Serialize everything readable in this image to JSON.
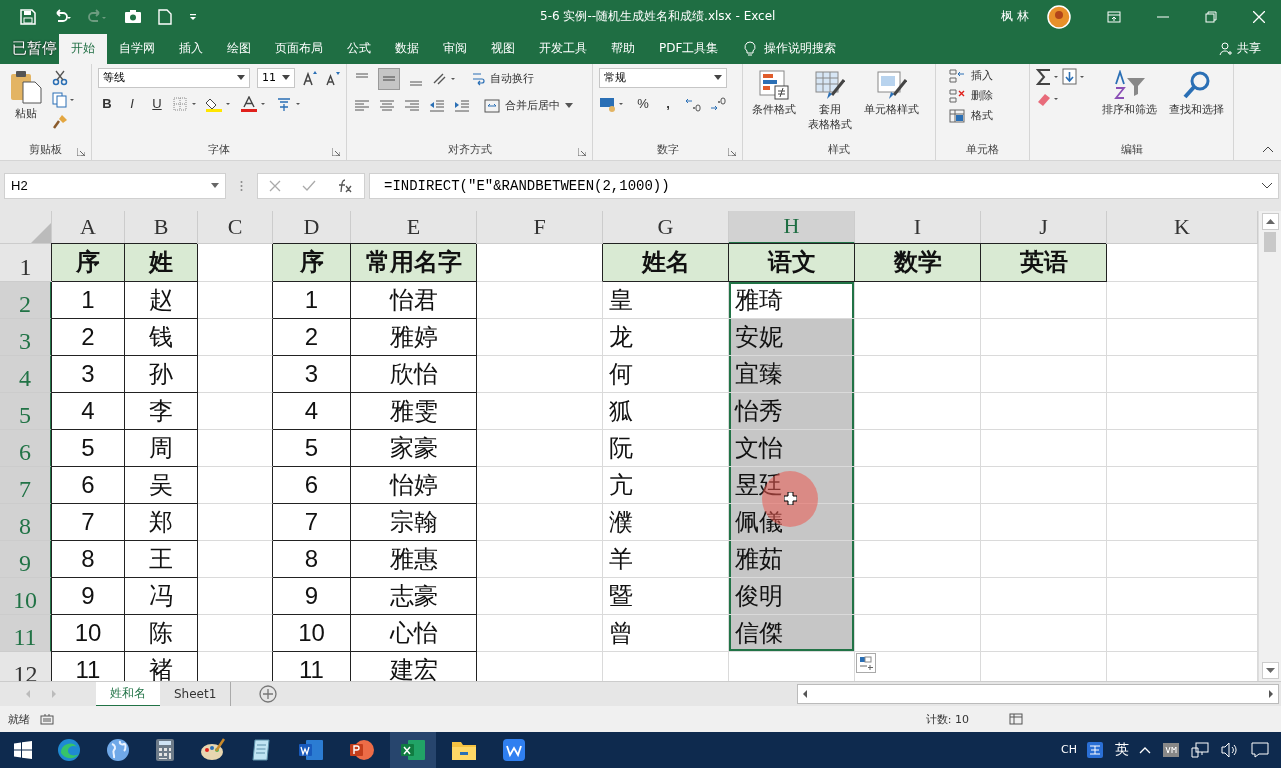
{
  "title_bar": {
    "title": "5-6 实例--随机生成姓名和成绩.xlsx  -  Excel",
    "user": "枫 林"
  },
  "recorder_status": "已暂停",
  "tabs": [
    {
      "label": "开始",
      "selected": true
    },
    {
      "label": "自学网",
      "selected": false
    },
    {
      "label": "插入",
      "selected": false
    },
    {
      "label": "绘图",
      "selected": false
    },
    {
      "label": "页面布局",
      "selected": false
    },
    {
      "label": "公式",
      "selected": false
    },
    {
      "label": "数据",
      "selected": false
    },
    {
      "label": "审阅",
      "selected": false
    },
    {
      "label": "视图",
      "selected": false
    },
    {
      "label": "开发工具",
      "selected": false
    },
    {
      "label": "帮助",
      "selected": false
    },
    {
      "label": "PDF工具集",
      "selected": false
    }
  ],
  "tell_me": "操作说明搜索",
  "share": "共享",
  "ribbon": {
    "clipboard": {
      "paste": "粘贴",
      "label": "剪贴板"
    },
    "font": {
      "name": "等线",
      "size": "11",
      "bold": "B",
      "italic": "I",
      "underline": "U",
      "label": "字体"
    },
    "alignment": {
      "wrap": "自动换行",
      "merge": "合并后居中",
      "label": "对齐方式"
    },
    "number": {
      "format": "常规",
      "percent": "%",
      "comma": ",",
      "label": "数字"
    },
    "styles": {
      "conditional": "条件格式",
      "table_format_1": "套用",
      "table_format_2": "表格格式",
      "cell_styles": "单元格样式",
      "label": "样式"
    },
    "cells": {
      "insert": "插入",
      "delete": "删除",
      "format": "格式",
      "label": "单元格"
    },
    "editing": {
      "sort": "排序和筛选",
      "find": "查找和选择",
      "label": "编辑"
    }
  },
  "formula_bar": {
    "name_box": "H2",
    "formula": "=INDIRECT(\"E\"&RANDBETWEEN(2,1000))"
  },
  "columns": [
    {
      "letter": "A",
      "selected": false
    },
    {
      "letter": "B",
      "selected": false
    },
    {
      "letter": "C",
      "selected": false
    },
    {
      "letter": "D",
      "selected": false
    },
    {
      "letter": "E",
      "selected": false
    },
    {
      "letter": "F",
      "selected": false
    },
    {
      "letter": "G",
      "selected": false
    },
    {
      "letter": "H",
      "selected": true
    },
    {
      "letter": "I",
      "selected": false
    },
    {
      "letter": "J",
      "selected": false
    },
    {
      "letter": "K",
      "selected": false
    }
  ],
  "rows": [
    {
      "number": "1",
      "selected": false,
      "cells": [
        {
          "kind": "header",
          "text": "序"
        },
        {
          "kind": "header",
          "text": "姓"
        },
        {
          "kind": "blank"
        },
        {
          "kind": "header",
          "text": "序"
        },
        {
          "kind": "header",
          "text": "常用名字"
        },
        {
          "kind": "blank"
        },
        {
          "kind": "header",
          "text": "姓名"
        },
        {
          "kind": "header",
          "text": "语文"
        },
        {
          "kind": "header",
          "text": "数学"
        },
        {
          "kind": "header",
          "text": "英语"
        },
        {
          "kind": "blank"
        }
      ]
    },
    {
      "number": "2",
      "selected": true,
      "cells": [
        {
          "kind": "table",
          "text": "1"
        },
        {
          "kind": "table",
          "text": "赵"
        },
        {
          "kind": "blank"
        },
        {
          "kind": "table",
          "text": "1"
        },
        {
          "kind": "table",
          "text": "怡君"
        },
        {
          "kind": "blank"
        },
        {
          "kind": "plain",
          "text": "皇"
        },
        {
          "kind": "active",
          "text": "雅琦"
        },
        {
          "kind": "blank"
        },
        {
          "kind": "blank"
        },
        {
          "kind": "blank"
        }
      ]
    },
    {
      "number": "3",
      "selected": true,
      "cells": [
        {
          "kind": "table",
          "text": "2"
        },
        {
          "kind": "table",
          "text": "钱"
        },
        {
          "kind": "blank"
        },
        {
          "kind": "table",
          "text": "2"
        },
        {
          "kind": "table",
          "text": "雅婷"
        },
        {
          "kind": "blank"
        },
        {
          "kind": "plain",
          "text": "龙"
        },
        {
          "kind": "selected",
          "text": "安妮"
        },
        {
          "kind": "blank"
        },
        {
          "kind": "blank"
        },
        {
          "kind": "blank"
        }
      ]
    },
    {
      "number": "4",
      "selected": true,
      "cells": [
        {
          "kind": "table",
          "text": "3"
        },
        {
          "kind": "table",
          "text": "孙"
        },
        {
          "kind": "blank"
        },
        {
          "kind": "table",
          "text": "3"
        },
        {
          "kind": "table",
          "text": "欣怡"
        },
        {
          "kind": "blank"
        },
        {
          "kind": "plain",
          "text": "何"
        },
        {
          "kind": "selected",
          "text": "宜臻"
        },
        {
          "kind": "blank"
        },
        {
          "kind": "blank"
        },
        {
          "kind": "blank"
        }
      ]
    },
    {
      "number": "5",
      "selected": true,
      "cells": [
        {
          "kind": "table",
          "text": "4"
        },
        {
          "kind": "table",
          "text": "李"
        },
        {
          "kind": "blank"
        },
        {
          "kind": "table",
          "text": "4"
        },
        {
          "kind": "table",
          "text": "雅雯"
        },
        {
          "kind": "blank"
        },
        {
          "kind": "plain",
          "text": "狐"
        },
        {
          "kind": "selected",
          "text": "怡秀"
        },
        {
          "kind": "blank"
        },
        {
          "kind": "blank"
        },
        {
          "kind": "blank"
        }
      ]
    },
    {
      "number": "6",
      "selected": true,
      "cells": [
        {
          "kind": "table",
          "text": "5"
        },
        {
          "kind": "table",
          "text": "周"
        },
        {
          "kind": "blank"
        },
        {
          "kind": "table",
          "text": "5"
        },
        {
          "kind": "table",
          "text": "家豪"
        },
        {
          "kind": "blank"
        },
        {
          "kind": "plain",
          "text": "阮"
        },
        {
          "kind": "selected",
          "text": "文怡"
        },
        {
          "kind": "blank"
        },
        {
          "kind": "blank"
        },
        {
          "kind": "blank"
        }
      ]
    },
    {
      "number": "7",
      "selected": true,
      "cells": [
        {
          "kind": "table",
          "text": "6"
        },
        {
          "kind": "table",
          "text": "吴"
        },
        {
          "kind": "blank"
        },
        {
          "kind": "table",
          "text": "6"
        },
        {
          "kind": "table",
          "text": "怡婷"
        },
        {
          "kind": "blank"
        },
        {
          "kind": "plain",
          "text": "亢"
        },
        {
          "kind": "selected",
          "text": "昱廷"
        },
        {
          "kind": "blank"
        },
        {
          "kind": "blank"
        },
        {
          "kind": "blank"
        }
      ]
    },
    {
      "number": "8",
      "selected": true,
      "cells": [
        {
          "kind": "table",
          "text": "7"
        },
        {
          "kind": "table",
          "text": "郑"
        },
        {
          "kind": "blank"
        },
        {
          "kind": "table",
          "text": "7"
        },
        {
          "kind": "table",
          "text": "宗翰"
        },
        {
          "kind": "blank"
        },
        {
          "kind": "plain",
          "text": "濮"
        },
        {
          "kind": "selected",
          "text": "佩儀"
        },
        {
          "kind": "blank"
        },
        {
          "kind": "blank"
        },
        {
          "kind": "blank"
        }
      ]
    },
    {
      "number": "9",
      "selected": true,
      "cells": [
        {
          "kind": "table",
          "text": "8"
        },
        {
          "kind": "table",
          "text": "王"
        },
        {
          "kind": "blank"
        },
        {
          "kind": "table",
          "text": "8"
        },
        {
          "kind": "table",
          "text": "雅惠"
        },
        {
          "kind": "blank"
        },
        {
          "kind": "plain",
          "text": "羊"
        },
        {
          "kind": "selected",
          "text": "雅茹"
        },
        {
          "kind": "blank"
        },
        {
          "kind": "blank"
        },
        {
          "kind": "blank"
        }
      ]
    },
    {
      "number": "10",
      "selected": true,
      "cells": [
        {
          "kind": "table",
          "text": "9"
        },
        {
          "kind": "table",
          "text": "冯"
        },
        {
          "kind": "blank"
        },
        {
          "kind": "table",
          "text": "9"
        },
        {
          "kind": "table",
          "text": "志豪"
        },
        {
          "kind": "blank"
        },
        {
          "kind": "plain",
          "text": "暨"
        },
        {
          "kind": "selected",
          "text": "俊明"
        },
        {
          "kind": "blank"
        },
        {
          "kind": "blank"
        },
        {
          "kind": "blank"
        }
      ]
    },
    {
      "number": "11",
      "selected": true,
      "cells": [
        {
          "kind": "table",
          "text": "10"
        },
        {
          "kind": "table",
          "text": "陈"
        },
        {
          "kind": "blank"
        },
        {
          "kind": "table",
          "text": "10"
        },
        {
          "kind": "table",
          "text": "心怡"
        },
        {
          "kind": "blank"
        },
        {
          "kind": "plain",
          "text": "曾"
        },
        {
          "kind": "selected",
          "text": "信傑"
        },
        {
          "kind": "blank"
        },
        {
          "kind": "blank"
        },
        {
          "kind": "blank"
        }
      ]
    },
    {
      "number": "12",
      "selected": false,
      "cells": [
        {
          "kind": "table",
          "text": "11"
        },
        {
          "kind": "table",
          "text": "褚"
        },
        {
          "kind": "blank"
        },
        {
          "kind": "table",
          "text": "11"
        },
        {
          "kind": "table",
          "text": "建宏"
        },
        {
          "kind": "blank"
        },
        {
          "kind": "blank"
        },
        {
          "kind": "blank"
        },
        {
          "kind": "blank"
        },
        {
          "kind": "blank"
        },
        {
          "kind": "blank"
        }
      ]
    }
  ],
  "sheet_tabs": [
    {
      "label": "姓和名",
      "selected": true
    },
    {
      "label": "Sheet1",
      "selected": false
    }
  ],
  "status_bar": {
    "ready": "就绪",
    "count": "计数: 10"
  },
  "taskbar": {
    "input_lang": "CH",
    "ime_mode": "英"
  }
}
